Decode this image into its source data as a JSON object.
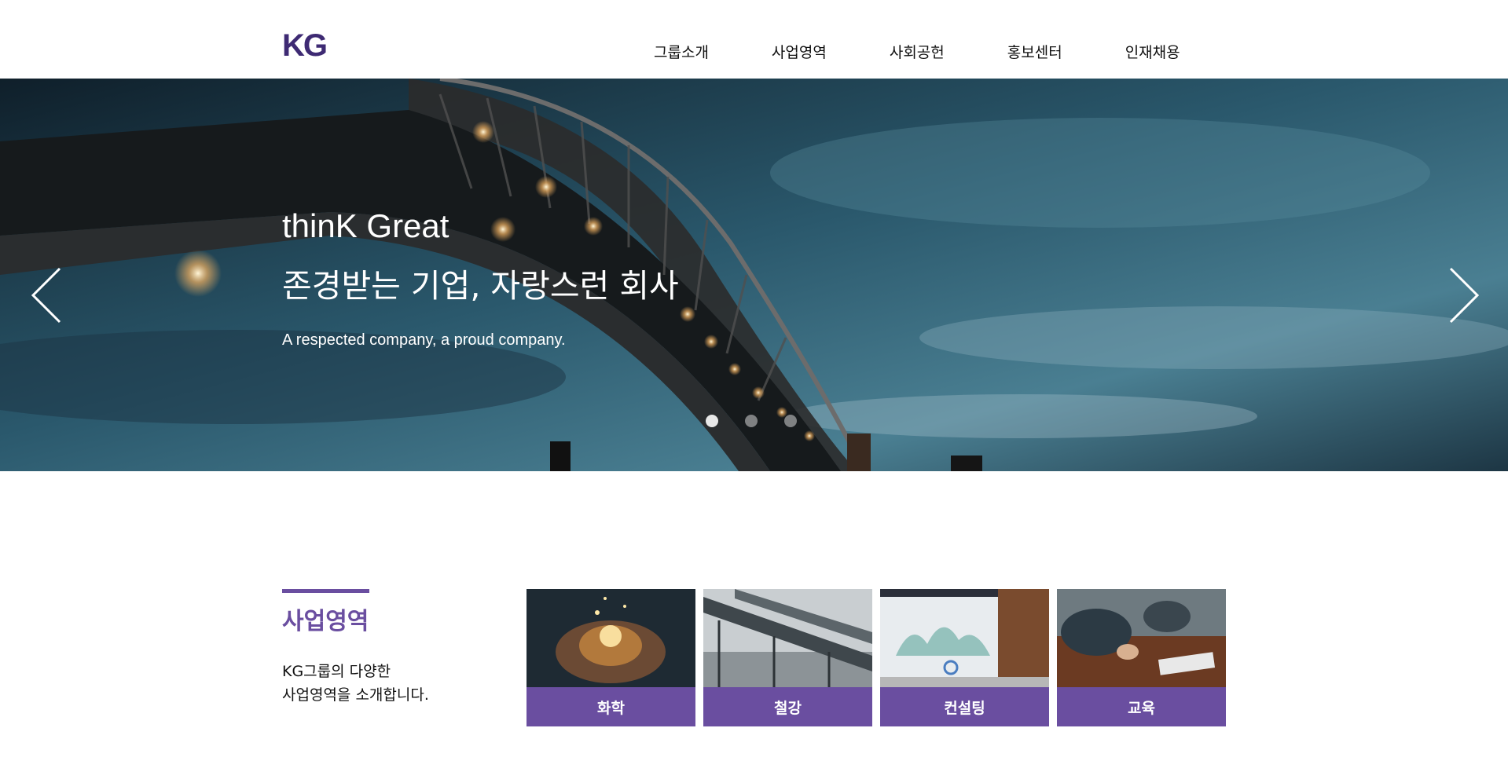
{
  "header": {
    "logo": "KG",
    "nav": [
      "그룹소개",
      "사업영역",
      "사회공헌",
      "홍보센터",
      "인재채용"
    ]
  },
  "hero": {
    "title": "thinK Great",
    "subtitle": "존경받는 기업, 자랑스런 회사",
    "description": "A respected company, a proud company.",
    "slide_count": 3,
    "active_slide": 1,
    "prev_icon": "chevron-left-icon",
    "next_icon": "chevron-right-icon"
  },
  "business": {
    "title": "사업영역",
    "description_line1": "KG그룹의 다양한",
    "description_line2": "사업영역을 소개합니다.",
    "cards": [
      {
        "label": "화학"
      },
      {
        "label": "철강"
      },
      {
        "label": "컨설팅"
      },
      {
        "label": "교육"
      }
    ]
  },
  "colors": {
    "brand": "#3e2a73",
    "accent": "#6a4ea0"
  }
}
